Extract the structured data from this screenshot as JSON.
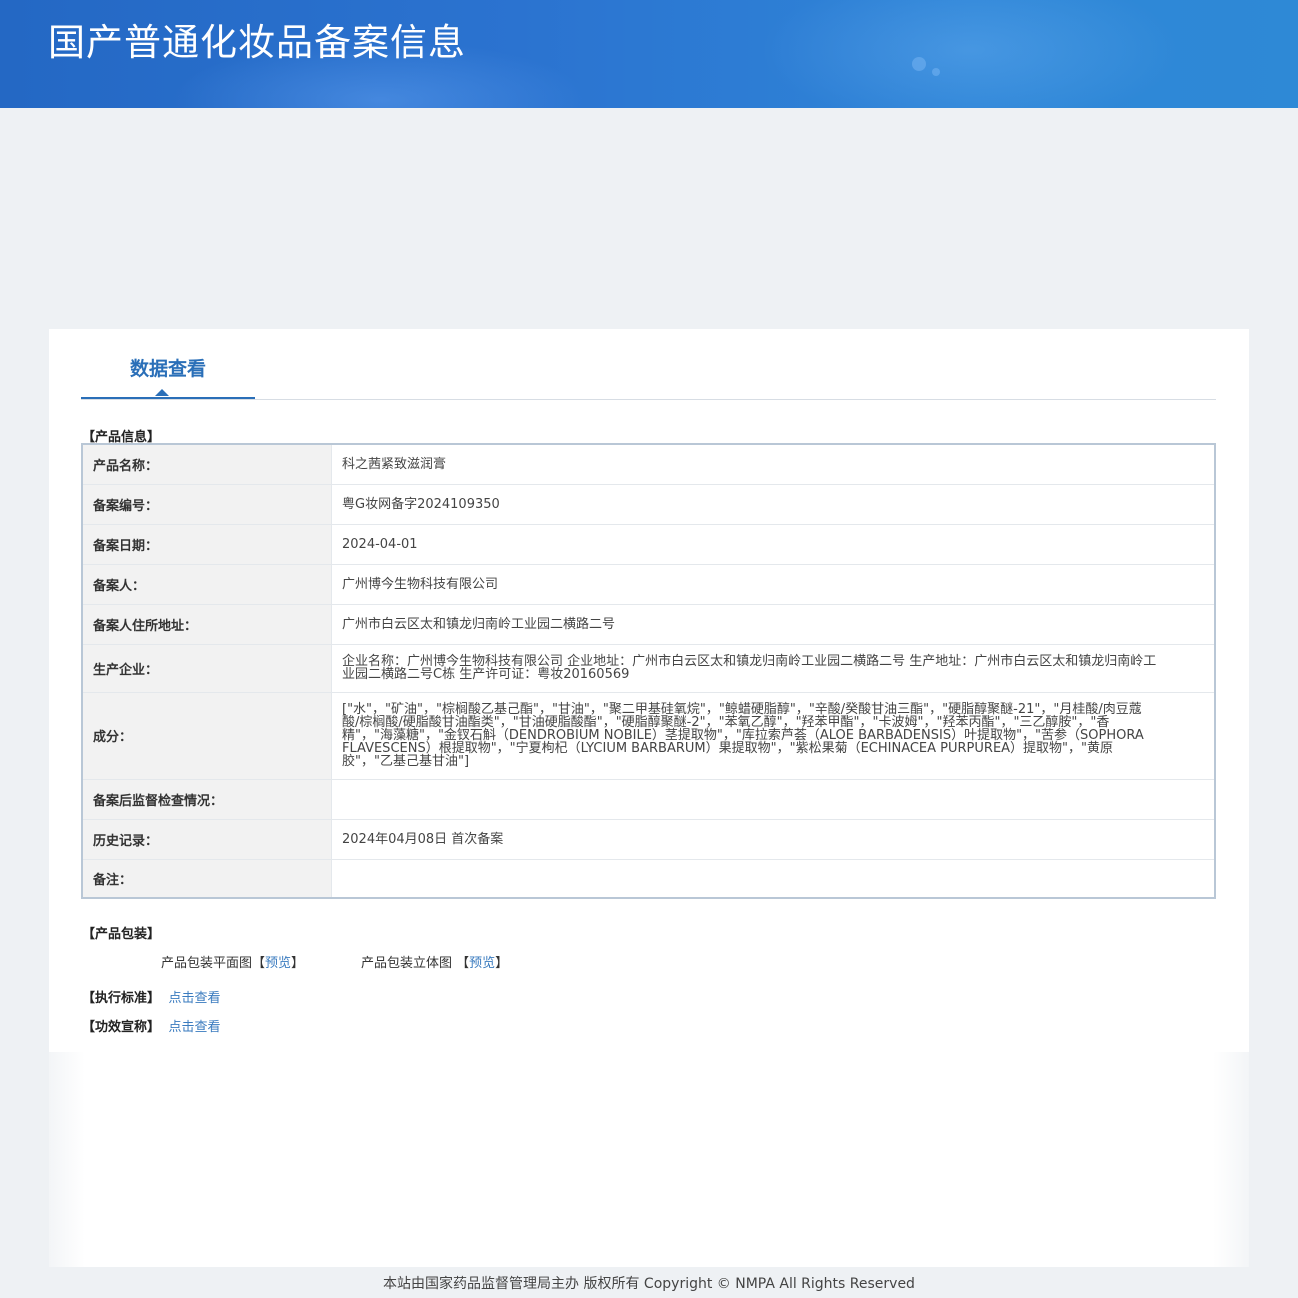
{
  "header": {
    "title": "国产普通化妆品备案信息"
  },
  "tabs": [
    {
      "label": "数据查看"
    }
  ],
  "product_info": {
    "section_label": "【产品信息】",
    "rows": [
      {
        "key": "产品名称：",
        "value": "科之茜紧致滋润膏"
      },
      {
        "key": "备案编号：",
        "value": "粤G妆网备字2024109350"
      },
      {
        "key": "备案日期：",
        "value": "2024-04-01"
      },
      {
        "key": "备案人：",
        "value": "广州博今生物科技有限公司"
      },
      {
        "key": "备案人住所地址：",
        "value": "广州市白云区太和镇龙归南岭工业园二横路二号"
      },
      {
        "key": "生产企业：",
        "value": "企业名称：广州博今生物科技有限公司 企业地址：广州市白云区太和镇龙归南岭工业园二横路二号 生产地址：广州市白云区太和镇龙归南岭工业园二横路二号C栋 生产许可证：粤妆20160569"
      },
      {
        "key": "成分：",
        "value": "[\"水\"，\"矿油\"，\"棕榈酸乙基己酯\"，\"甘油\"，\"聚二甲基硅氧烷\"，\"鲸蜡硬脂醇\"，\"辛酸/癸酸甘油三酯\"，\"硬脂醇聚醚-21\"，\"月桂酸/肉豆蔻酸/棕榈酸/硬脂酸甘油酯类\"，\"甘油硬脂酸酯\"，\"硬脂醇聚醚-2\"，\"苯氧乙醇\"，\"羟苯甲酯\"，\"卡波姆\"，\"羟苯丙酯\"，\"三乙醇胺\"，\"香精\"，\"海藻糖\"，\"金钗石斛（DENDROBIUM NOBILE）茎提取物\"，\"库拉索芦荟（ALOE BARBADENSIS）叶提取物\"，\"苦参（SOPHORA FLAVESCENS）根提取物\"，\"宁夏枸杞（LYCIUM BARBARUM）果提取物\"，\"紫松果菊（ECHINACEA PURPUREA）提取物\"，\"黄原胶\"，\"乙基己基甘油\"]"
      },
      {
        "key": "备案后监督检查情况：",
        "value": ""
      },
      {
        "key": "历史记录：",
        "value": "2024年04月08日 首次备案"
      },
      {
        "key": "备注：",
        "value": ""
      }
    ]
  },
  "packaging": {
    "section_label": "【产品包装】",
    "flat_label": "产品包装平面图",
    "flat_link": "预览",
    "stereo_label": "产品包装立体图",
    "stereo_link": "预览"
  },
  "standard": {
    "label": "【执行标准】",
    "link": "点击查看"
  },
  "efficacy": {
    "label": "【功效宣称】",
    "link": "点击查看"
  },
  "footer": {
    "text": "本站由国家药品监督管理局主办 版权所有 Copyright © NMPA All Rights Reserved"
  }
}
